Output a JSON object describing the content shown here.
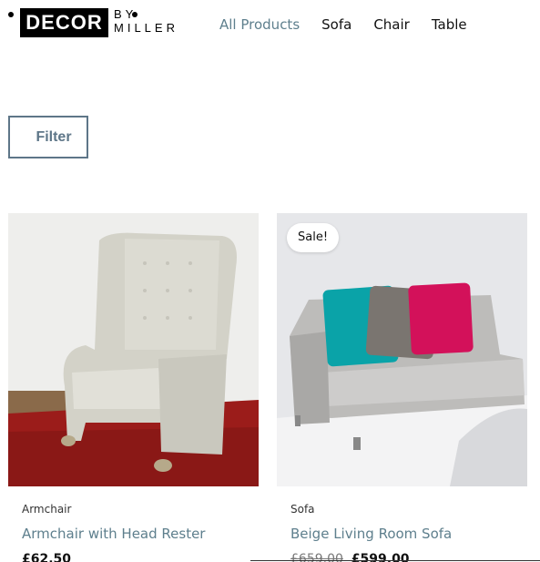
{
  "logo": {
    "word": "DECOR",
    "by": "BY",
    "miller": "MILLER"
  },
  "nav": [
    {
      "label": "All Products",
      "active": true
    },
    {
      "label": "Sofa"
    },
    {
      "label": "Chair"
    },
    {
      "label": "Table"
    }
  ],
  "filter": {
    "label": "Filter"
  },
  "products": [
    {
      "category": "Armchair",
      "title": "Armchair with Head Rester",
      "price": "£62.50",
      "image": "armchair-photo"
    },
    {
      "badge": "Sale!",
      "category": "Sofa",
      "title": "Beige Living Room Sofa",
      "old_price": "£659.00",
      "price": "£599.00",
      "image": "sofa-photo",
      "pillow_colors": [
        "#0aa3a8",
        "#7a7570",
        "#d3115a"
      ]
    }
  ]
}
